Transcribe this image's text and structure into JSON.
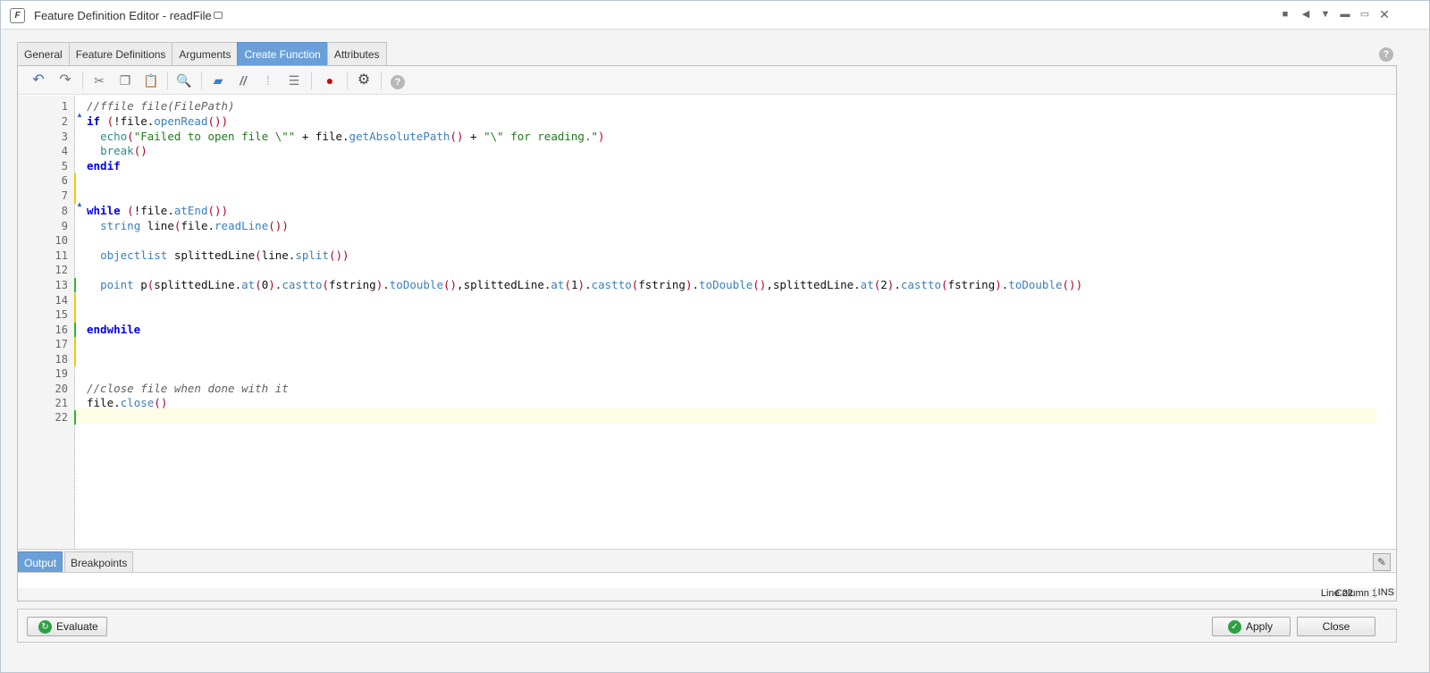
{
  "window": {
    "title": "Feature Definition Editor - readFile",
    "app_icon_letter": "F"
  },
  "tabs": [
    {
      "label": "General",
      "active": false
    },
    {
      "label": "Feature Definitions",
      "active": false
    },
    {
      "label": "Arguments",
      "active": false
    },
    {
      "label": "Create Function",
      "active": true
    },
    {
      "label": "Attributes",
      "active": false
    }
  ],
  "toolbar_icons": [
    "undo-icon",
    "redo-icon",
    "cut-icon",
    "copy-icon",
    "paste-icon",
    "find-icon",
    "folder-icon",
    "comment-icon",
    "uncomment-icon",
    "indent-icon",
    "breakpoint-icon",
    "settings-icon",
    "help-icon"
  ],
  "code": {
    "lines": [
      "//ffile file(FilePath)",
      "if (!file.openRead())",
      "  echo(\"Failed to open file \\\"\" + file.getAbsolutePath() + \"\\\" for reading.\")",
      "  break()",
      "endif",
      "",
      "",
      "while (!file.atEnd())",
      "  string line(file.readLine())",
      "",
      "  objectlist splittedLine(line.split())",
      "",
      "  point p(splittedLine.at(0).castto(fstring).toDouble(),splittedLine.at(1).castto(fstring).toDouble(),splittedLine.at(2).castto(fstring).toDouble())",
      "",
      "",
      "endwhile",
      "",
      "",
      "",
      "//close file when done with it",
      "file.close()",
      ""
    ],
    "current_line": 22
  },
  "bottom_tabs": [
    {
      "label": "Output",
      "active": true
    },
    {
      "label": "Breakpoints",
      "active": false
    }
  ],
  "status": {
    "line": "Line 22",
    "column": "Column 1",
    "mode": "INS"
  },
  "footer": {
    "evaluate_label": "Evaluate",
    "apply_label": "Apply",
    "close_label": "Close"
  },
  "colors": {
    "active_tab": "#6a9fd8",
    "keyword": "#0000ee",
    "string": "#1e7a1e",
    "comment": "#606060",
    "apply_check": "#2ea043"
  }
}
